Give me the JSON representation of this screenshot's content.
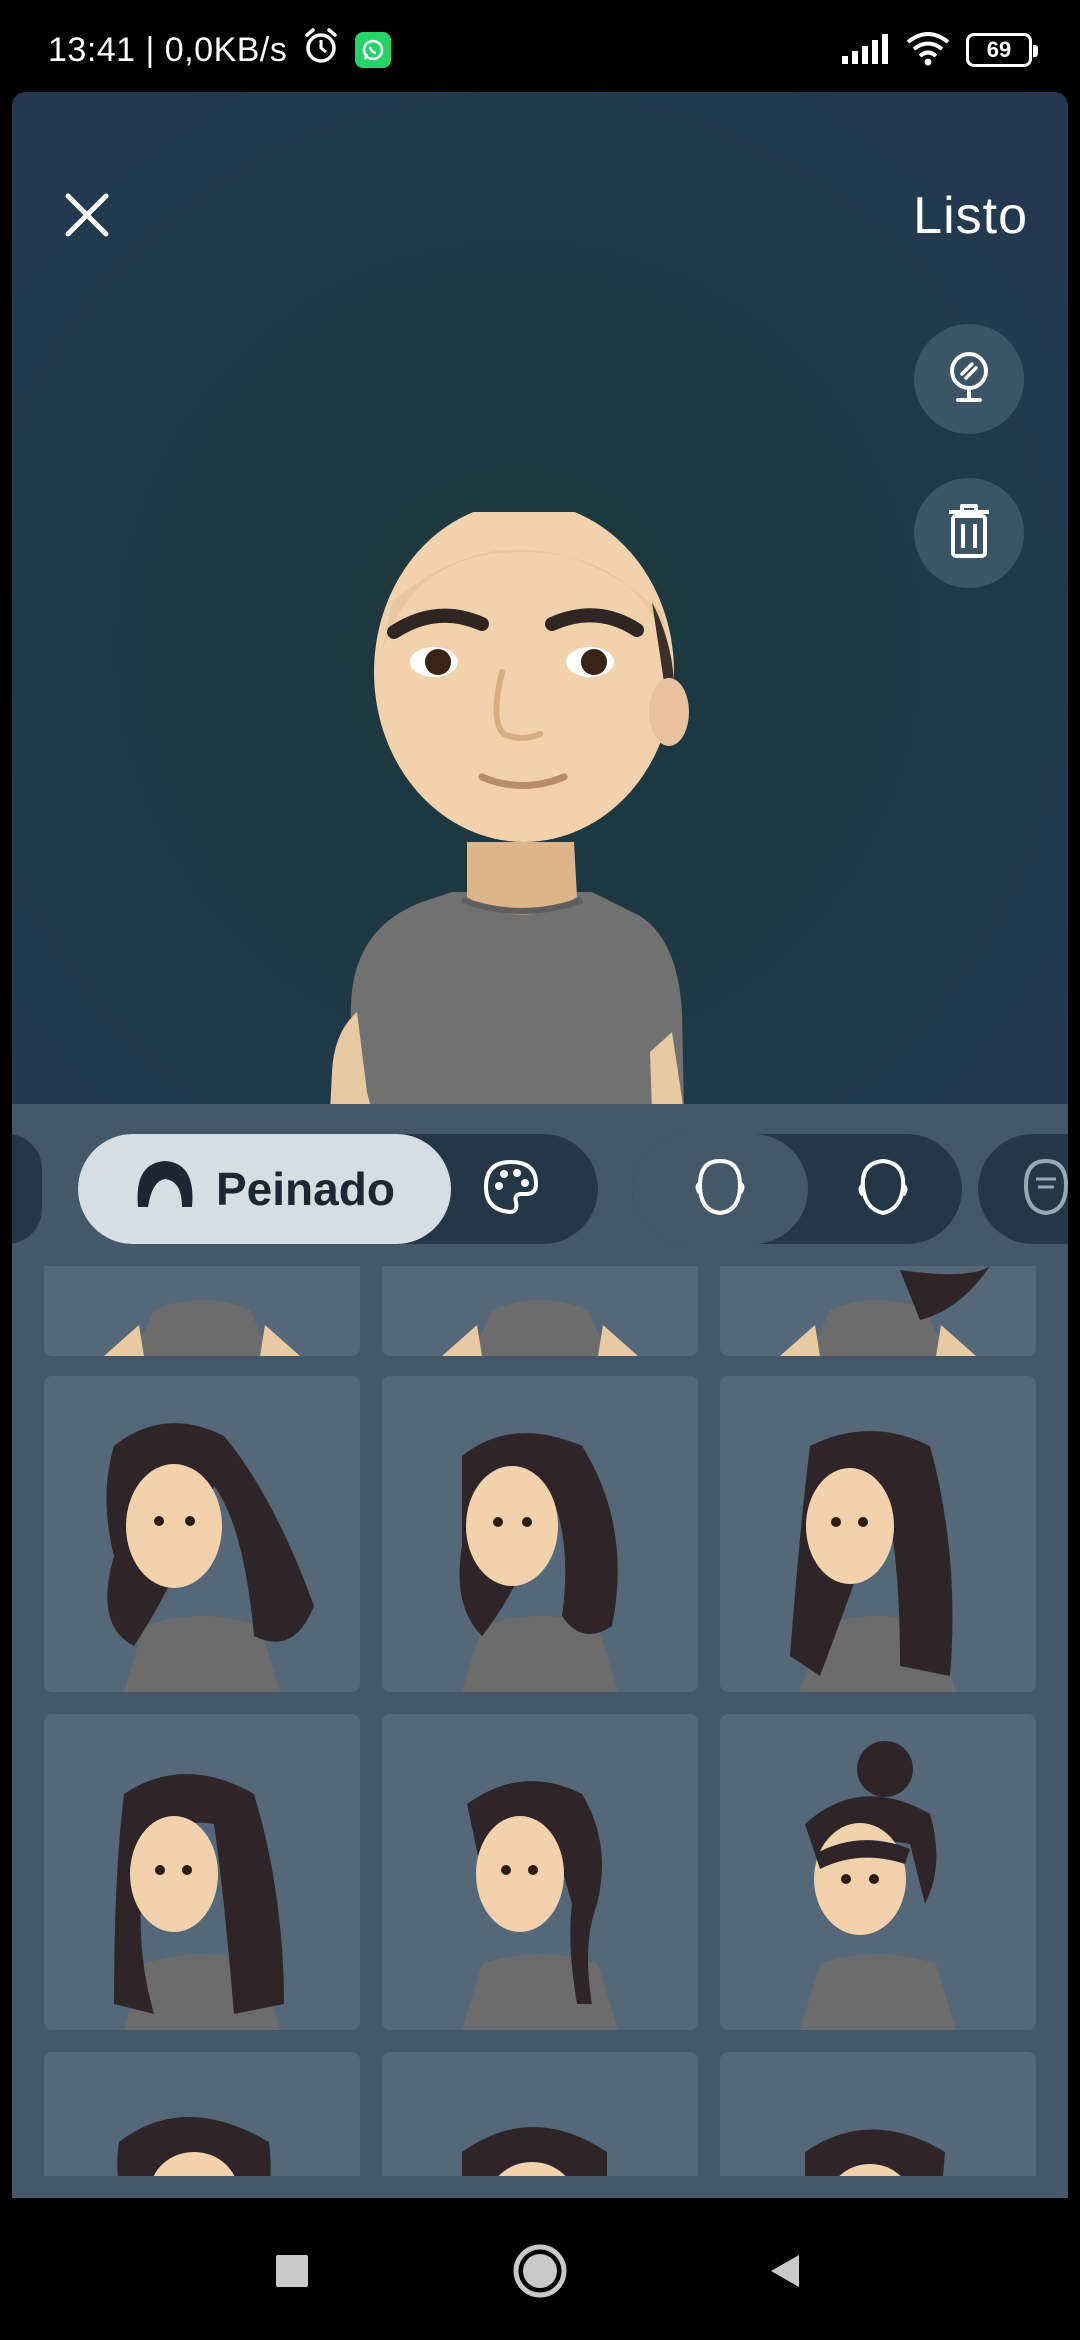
{
  "status_bar": {
    "time_speed": "13:41 | 0,0KB/s",
    "battery": "69",
    "icons": [
      "alarm-icon",
      "whatsapp-icon",
      "signal-icon",
      "wifi-icon",
      "battery-icon"
    ]
  },
  "header": {
    "close_icon": "close-icon",
    "done_label": "Listo"
  },
  "side_actions": [
    "mirror-icon",
    "trash-icon"
  ],
  "category_tabs": {
    "active_label": "Peinado",
    "active_icon": "hair-icon",
    "secondary_icon": "palette-icon",
    "shape_icons": [
      "head-shape-1-icon",
      "head-shape-2-icon",
      "head-shape-3-icon"
    ]
  },
  "hairstyles": {
    "rows_visible": 4,
    "items": [
      "partial-top-1",
      "partial-top-2",
      "partial-top-3",
      "long-wavy",
      "medium-wavy",
      "long-straight",
      "long-side-part",
      "low-ponytail",
      "top-bun-bangs",
      "partial-bottom-1",
      "partial-bottom-2",
      "partial-bottom-3"
    ]
  },
  "colors": {
    "stage_bg": "#1f3a45",
    "panel_bg": "#45586a",
    "tile_bg": "#54687a",
    "pill_dark": "#253747",
    "pill_active": "#d6dde3"
  },
  "nav": [
    "recents-icon",
    "home-icon",
    "back-icon"
  ]
}
